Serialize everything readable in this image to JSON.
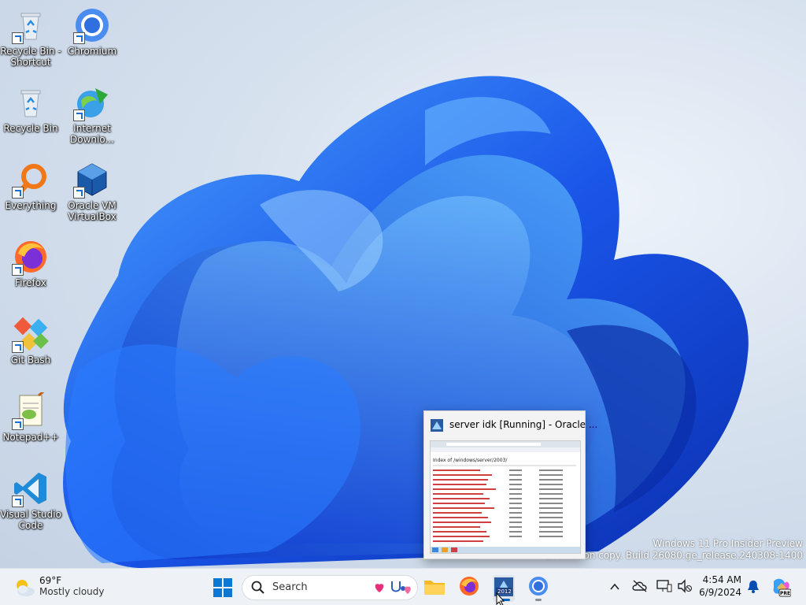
{
  "desktop_icons": [
    {
      "label": "Recycle Bin - Shortcut",
      "icon": "recycle-bin-icon"
    },
    {
      "label": "Chromium",
      "icon": "chromium-icon"
    },
    {
      "label": "Recycle Bin",
      "icon": "recycle-bin-icon"
    },
    {
      "label": "Internet Downlo...",
      "icon": "internet-download-manager-icon"
    },
    {
      "label": "Everything",
      "icon": "everything-search-icon"
    },
    {
      "label": "Oracle VM VirtualBox",
      "icon": "virtualbox-icon"
    },
    {
      "label": "Firefox",
      "icon": "firefox-icon"
    },
    {
      "label": "Git Bash",
      "icon": "git-bash-icon"
    },
    {
      "label": "Notepad++",
      "icon": "notepad-plus-plus-icon"
    },
    {
      "label": "Visual Studio Code",
      "icon": "vscode-icon"
    }
  ],
  "watermark": {
    "line1": "Windows 11 Pro Insider Preview",
    "line2": "Evaluation copy. Build 26080.ge_release.240308-1400"
  },
  "preview": {
    "title": "server idk [Running] - Oracle ...",
    "thumb_heading": "Index of /windows/server/2003/"
  },
  "taskbar": {
    "weather": {
      "temp": "69°F",
      "condition": "Mostly cloudy"
    },
    "search_placeholder": "Search",
    "clock": {
      "time": "4:54 AM",
      "date": "6/9/2024"
    },
    "pinned": [
      "start-icon",
      "file-explorer-icon",
      "firefox-icon",
      "virtualbox-vm-icon",
      "chromium-icon"
    ]
  },
  "colors": {
    "accent": "#0067c0",
    "bloom": "#1f5fe0"
  }
}
